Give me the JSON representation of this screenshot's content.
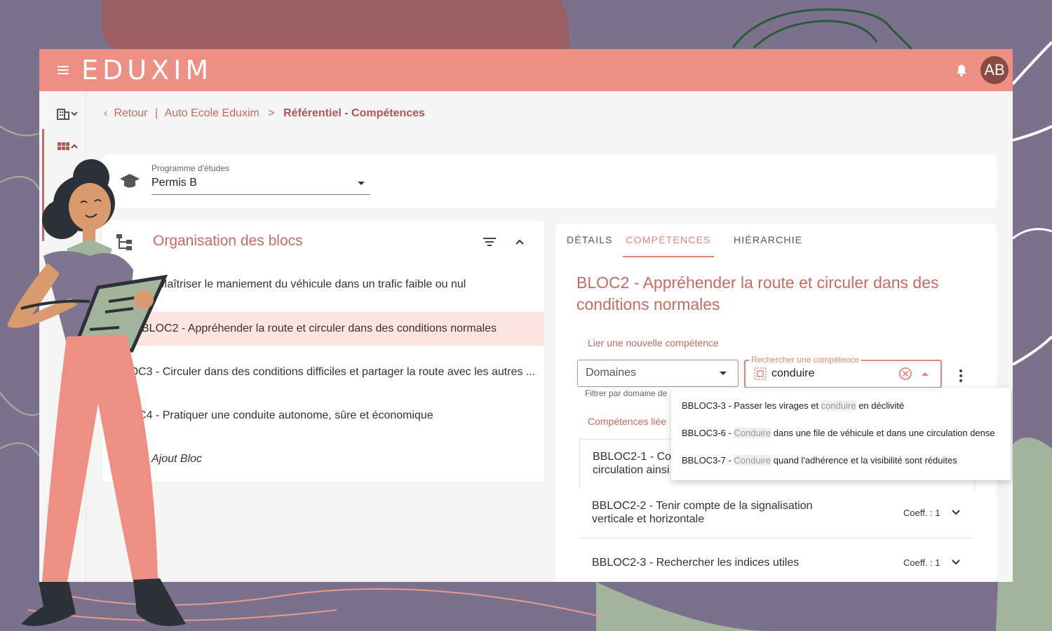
{
  "app": {
    "logo_text": "EDUXIM",
    "avatar_initials": "AB",
    "accent_color": "#ed9083",
    "text_accent_color": "#c66a64"
  },
  "breadcrumb": {
    "back": "Retour",
    "separator": "|",
    "school": "Auto Ecole Eduxim",
    "arrow": ">",
    "current": "Référentiel - Compétences"
  },
  "programme": {
    "label": "Programme d'études",
    "value": "Permis B"
  },
  "blocs": {
    "title": "Organisation des blocs",
    "items": [
      {
        "label": "Maîtriser le maniement du véhicule dans un trafic faible ou nul"
      },
      {
        "label": "BLOC2 - Appréhender la route et circuler dans des conditions normales"
      },
      {
        "label": "BLOC3 - Circuler dans des conditions difficiles et partager la route avec les autres ..."
      },
      {
        "label": "BLOC4 - Pratiquer une conduite autonome, sûre et économique"
      }
    ],
    "add_label": "Ajout Bloc"
  },
  "tabs": [
    {
      "label": "DÉTAILS"
    },
    {
      "label": "COMPÉTENCES"
    },
    {
      "label": "HIÉRARCHIE"
    }
  ],
  "detail": {
    "heading": "BLOC2 - Appréhender la route et circuler dans des conditions normales",
    "link_label": "Lier une nouvelle compétence",
    "domain_select": "Domaines",
    "domain_hint": "Filtrer par domaine de",
    "search_legend": "Rechercher une compétence",
    "search_value": "conduire",
    "linked_label": "Compétences liée"
  },
  "dropdown": {
    "options": [
      {
        "prefix": "BBLOC3-3 - Passer les virages et ",
        "match": "conduire",
        "suffix": " en déclivité"
      },
      {
        "prefix": "BBLOC3-6 - ",
        "match": "Conduire",
        "suffix": " dans une file de véhicule et dans une circulation dense"
      },
      {
        "prefix": "BBLOC3-7 - ",
        "match": "Conduire",
        "suffix": " quand l'adhérence et la visibilité sont réduites"
      }
    ]
  },
  "competences": [
    {
      "title": "BBLOC2-1 - Cor\ncirculation ainsi",
      "coeff": ""
    },
    {
      "title": "BBLOC2-2 - Tenir compte de la signalisation verticale et horizontale",
      "coeff": "Coeff. : 1"
    },
    {
      "title": "BBLOC2-3 - Rechercher les indices utiles",
      "coeff": "Coeff. : 1"
    }
  ]
}
